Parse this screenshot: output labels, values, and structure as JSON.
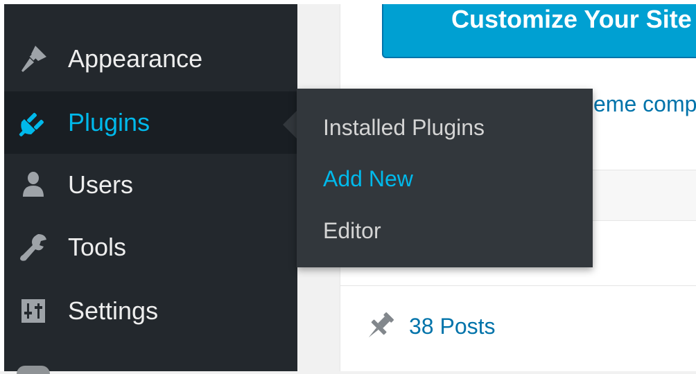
{
  "sidebar": {
    "items": [
      {
        "label": "Appearance",
        "icon": "paintbrush-icon"
      },
      {
        "label": "Plugins",
        "icon": "plug-icon",
        "current": true
      },
      {
        "label": "Users",
        "icon": "user-icon"
      },
      {
        "label": "Tools",
        "icon": "wrench-icon"
      },
      {
        "label": "Settings",
        "icon": "settings-sliders-icon"
      }
    ]
  },
  "flyout": {
    "items": [
      {
        "label": "Installed Plugins"
      },
      {
        "label": "Add New",
        "active": true
      },
      {
        "label": "Editor"
      }
    ]
  },
  "content": {
    "customize_button": "Customize Your Site",
    "theme_link_fragment": "eme comp",
    "posts_link": "38 Posts"
  },
  "colors": {
    "sidebar_bg": "#23282d",
    "current_bg": "#191e23",
    "flyout_bg": "#32373c",
    "accent": "#00b9eb",
    "button_bg": "#00a0d2",
    "link": "#0073aa"
  }
}
